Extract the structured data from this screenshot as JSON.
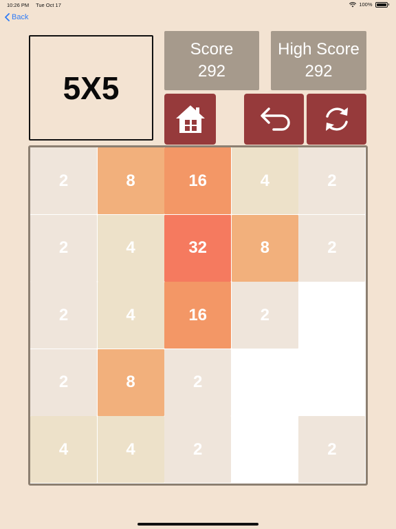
{
  "status": {
    "time": "10:26 PM",
    "date": "Tue Oct 17",
    "battery": "100%"
  },
  "nav": {
    "back_label": "Back"
  },
  "title": "5X5",
  "score": {
    "label": "Score",
    "value": "292"
  },
  "high_score": {
    "label": "High Score",
    "value": "292"
  },
  "icons": {
    "home": "home-icon",
    "undo": "undo-icon",
    "refresh": "refresh-icon"
  },
  "colors": {
    "background": "#f3e3d2",
    "score_box": "#a69a8c",
    "buttons": "#963a3b",
    "board_border": "#8c7f71",
    "tile_2": "#efe5db",
    "tile_4": "#ede1c9",
    "tile_8": "#f2b07c",
    "tile_16": "#f39766",
    "tile_32": "#f57a5f"
  },
  "board": {
    "size": 5,
    "tiles": [
      {
        "row": 0,
        "col": 0,
        "value": "2"
      },
      {
        "row": 0,
        "col": 1,
        "value": "8"
      },
      {
        "row": 0,
        "col": 2,
        "value": "16"
      },
      {
        "row": 0,
        "col": 3,
        "value": "4"
      },
      {
        "row": 0,
        "col": 4,
        "value": "2"
      },
      {
        "row": 1,
        "col": 0,
        "value": "2"
      },
      {
        "row": 1,
        "col": 1,
        "value": "4"
      },
      {
        "row": 1,
        "col": 2,
        "value": "32"
      },
      {
        "row": 1,
        "col": 3,
        "value": "8"
      },
      {
        "row": 1,
        "col": 4,
        "value": "2"
      },
      {
        "row": 2,
        "col": 0,
        "value": "2"
      },
      {
        "row": 2,
        "col": 1,
        "value": "4"
      },
      {
        "row": 2,
        "col": 2,
        "value": "16"
      },
      {
        "row": 2,
        "col": 3,
        "value": "2"
      },
      {
        "row": 3,
        "col": 0,
        "value": "2"
      },
      {
        "row": 3,
        "col": 1,
        "value": "8"
      },
      {
        "row": 3,
        "col": 2,
        "value": "2"
      },
      {
        "row": 4,
        "col": 0,
        "value": "4"
      },
      {
        "row": 4,
        "col": 1,
        "value": "4"
      },
      {
        "row": 4,
        "col": 2,
        "value": "2"
      },
      {
        "row": 4,
        "col": 4,
        "value": "2"
      }
    ]
  }
}
